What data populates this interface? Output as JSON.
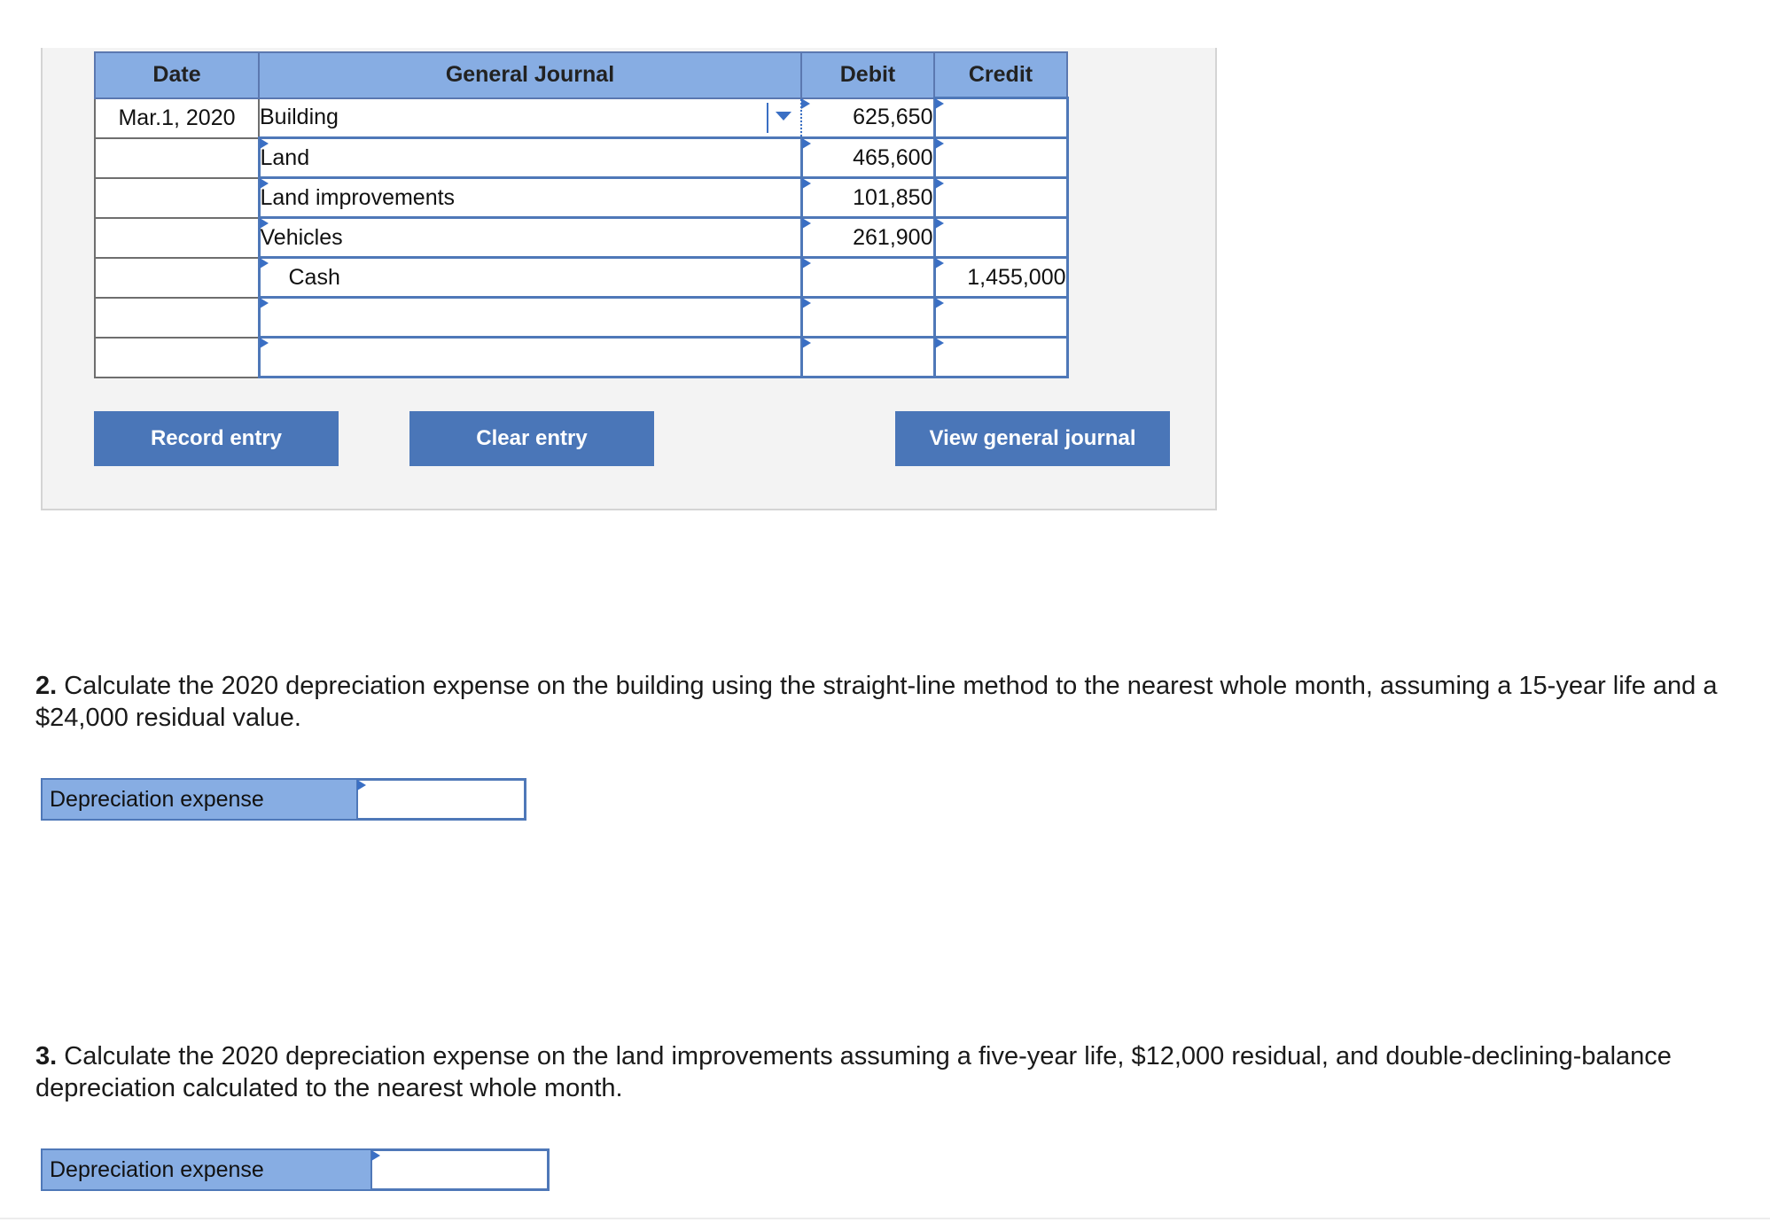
{
  "journal": {
    "headers": {
      "date": "Date",
      "journal": "General Journal",
      "debit": "Debit",
      "credit": "Credit"
    },
    "rows": [
      {
        "date": "Mar.1, 2020",
        "account": "Building",
        "debit": "625,650",
        "credit": ""
      },
      {
        "date": "",
        "account": "Land",
        "debit": "465,600",
        "credit": ""
      },
      {
        "date": "",
        "account": "Land improvements",
        "debit": "101,850",
        "credit": ""
      },
      {
        "date": "",
        "account": "Vehicles",
        "debit": "261,900",
        "credit": ""
      },
      {
        "date": "",
        "account": "Cash",
        "debit": "",
        "credit": "1,455,000"
      },
      {
        "date": "",
        "account": "",
        "debit": "",
        "credit": ""
      },
      {
        "date": "",
        "account": "",
        "debit": "",
        "credit": ""
      }
    ]
  },
  "buttons": {
    "record": "Record entry",
    "clear": "Clear entry",
    "view": "View general journal"
  },
  "q2": {
    "number": "2.",
    "text": " Calculate the 2020 depreciation expense on the building using the straight-line method to the nearest whole month, assuming a 15-year life and a $24,000 residual value.",
    "label": "Depreciation expense",
    "value": ""
  },
  "q3": {
    "number": "3.",
    "text": " Calculate the 2020 depreciation expense on the land improvements assuming a five-year life, $12,000 residual, and double-declining-balance depreciation calculated to the nearest whole month.",
    "label": "Depreciation expense",
    "value": ""
  },
  "colors": {
    "header": "#87ade3",
    "button": "#4a76b8",
    "border": "#4f78b8"
  }
}
